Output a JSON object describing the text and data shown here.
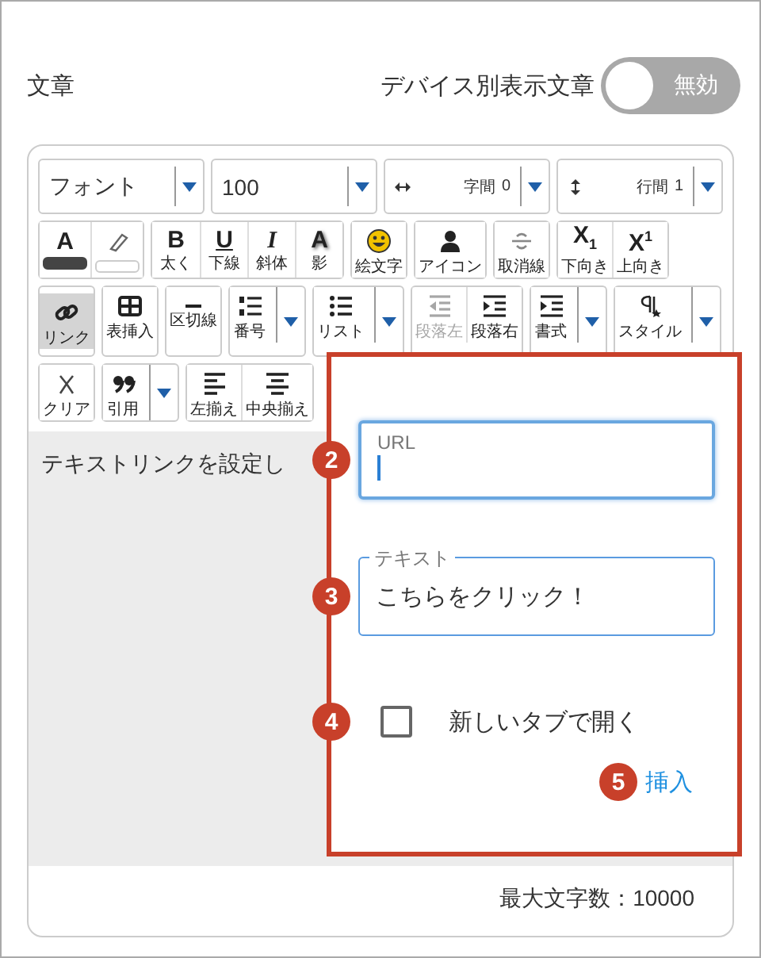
{
  "header": {
    "title": "文章",
    "device_toggle": {
      "label": "デバイス別表示文章",
      "on": false,
      "state_text": "無効"
    }
  },
  "toolbar": {
    "selects": [
      {
        "kind": "font",
        "value": "フォント"
      },
      {
        "kind": "size",
        "value": "100"
      },
      {
        "kind": "spacing",
        "label": "字間",
        "value": "0"
      },
      {
        "kind": "lineheight",
        "label": "行間",
        "value": "1"
      }
    ],
    "rows": [
      {
        "groups": [
          {
            "buttons": [
              {
                "kind": "textcolor",
                "glyph": "A",
                "selected": false,
                "disabled": false,
                "dropdown": false
              },
              {
                "kind": "highlight",
                "selected": false,
                "disabled": false,
                "dropdown": false
              }
            ]
          },
          {
            "buttons": [
              {
                "kind": "bold",
                "glyph": "B",
                "label": "太く",
                "selected": false,
                "disabled": false,
                "dropdown": false
              },
              {
                "kind": "underline",
                "glyph": "U",
                "label": "下線",
                "selected": false,
                "disabled": false,
                "dropdown": false
              },
              {
                "kind": "italic",
                "glyph": "I",
                "label": "斜体",
                "selected": false,
                "disabled": false,
                "dropdown": false
              },
              {
                "kind": "shadow",
                "glyph": "A",
                "label": "影",
                "selected": false,
                "disabled": false,
                "dropdown": false
              }
            ]
          },
          {
            "buttons": [
              {
                "kind": "emoji",
                "label": "絵文字",
                "selected": false,
                "disabled": false,
                "dropdown": false
              }
            ]
          },
          {
            "buttons": [
              {
                "kind": "person",
                "label": "アイコン",
                "selected": false,
                "disabled": false,
                "dropdown": false
              }
            ]
          },
          {
            "buttons": [
              {
                "kind": "strike",
                "label": "取消線",
                "selected": false,
                "disabled": false,
                "dropdown": false
              }
            ]
          },
          {
            "buttons": [
              {
                "kind": "subscript",
                "glyph": "X$_{1}$",
                "label": "下向き",
                "selected": false,
                "disabled": false,
                "dropdown": false
              },
              {
                "kind": "superscript",
                "glyph": "X$^{1}$",
                "label": "上向き",
                "selected": false,
                "disabled": false,
                "dropdown": false
              }
            ]
          }
        ]
      },
      {
        "groups": [
          {
            "buttons": [
              {
                "kind": "link",
                "label": "リンク",
                "selected": true,
                "disabled": false,
                "dropdown": false
              }
            ]
          },
          {
            "buttons": [
              {
                "kind": "table",
                "label": "表挿入",
                "selected": false,
                "disabled": false,
                "dropdown": false
              }
            ]
          },
          {
            "buttons": [
              {
                "kind": "rule",
                "label": "区切線",
                "selected": false,
                "disabled": false,
                "dropdown": false
              }
            ]
          },
          {
            "buttons": [
              {
                "kind": "numbered",
                "label": "番号",
                "selected": false,
                "disabled": false,
                "dropdown": true
              }
            ]
          },
          {
            "buttons": [
              {
                "kind": "bullets",
                "label": "リスト",
                "selected": false,
                "disabled": false,
                "dropdown": true
              }
            ]
          },
          {
            "buttons": [
              {
                "kind": "outdent",
                "label": "段落左",
                "selected": false,
                "disabled": true,
                "dropdown": false
              },
              {
                "kind": "indent",
                "label": "段落右",
                "selected": false,
                "disabled": false,
                "dropdown": false
              }
            ]
          },
          {
            "buttons": [
              {
                "kind": "format",
                "label": "書式",
                "selected": false,
                "disabled": false,
                "dropdown": true
              }
            ]
          },
          {
            "buttons": [
              {
                "kind": "style",
                "label": "スタイル",
                "selected": false,
                "disabled": false,
                "dropdown": true
              }
            ]
          }
        ]
      },
      {
        "groups": [
          {
            "buttons": [
              {
                "kind": "clear",
                "label": "クリア",
                "selected": false,
                "disabled": false,
                "dropdown": false
              }
            ]
          },
          {
            "buttons": [
              {
                "kind": "quote",
                "label": "引用",
                "selected": false,
                "disabled": false,
                "dropdown": true
              }
            ]
          },
          {
            "buttons": [
              {
                "kind": "alignleft",
                "label": "左揃え",
                "selected": false,
                "disabled": false,
                "dropdown": false
              },
              {
                "kind": "aligncenter",
                "label": "中央揃え",
                "selected": false,
                "disabled": false,
                "dropdown": false
              }
            ]
          }
        ]
      }
    ]
  },
  "editor": {
    "text": "テキストリンクを設定し"
  },
  "footer": {
    "counter": "最大文字数：10000"
  },
  "link_popup": {
    "url_field": {
      "badge": "2",
      "label": "URL",
      "focused": true
    },
    "text_field": {
      "badge": "3",
      "label": "テキスト",
      "value": "こちらをクリック！",
      "focused": false
    },
    "new_tab": {
      "badge": "4",
      "label": "新しいタブで開く",
      "checked": false
    },
    "insert": {
      "badge": "5",
      "label": "挿入"
    }
  }
}
